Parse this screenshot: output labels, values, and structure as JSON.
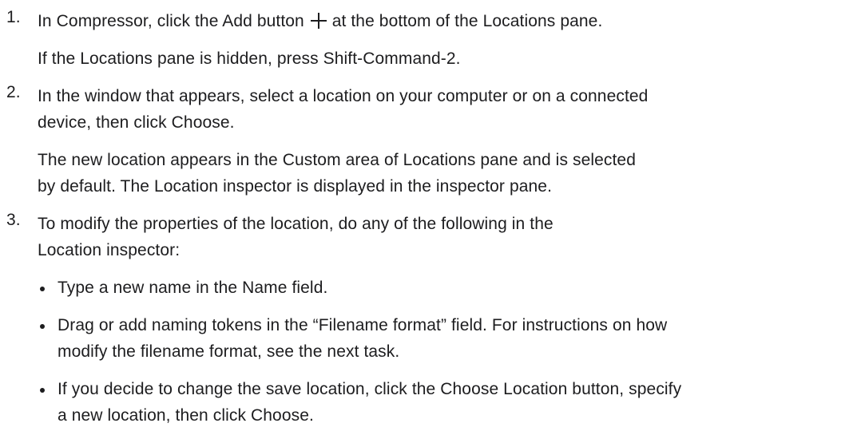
{
  "steps": [
    {
      "number": "1.",
      "line1_pre": "In Compressor, click the Add button",
      "line1_icon": "plus-icon",
      "line1_post": "at the bottom of the Locations pane.",
      "note": "If the Locations pane is hidden, press Shift-Command-2."
    },
    {
      "number": "2.",
      "line1": "In the window that appears, select a location on your computer or on a connected",
      "line2": "device, then click Choose.",
      "note_line1": "The new location appears in the Custom area of Locations pane and is selected",
      "note_line2": "by default. The Location inspector is displayed in the inspector pane."
    },
    {
      "number": "3.",
      "line1": "To modify the properties of the location, do any of the following in the",
      "line2": "Location inspector:",
      "bullets": [
        {
          "line1": "Type a new name in the Name field."
        },
        {
          "line1": "Drag or add naming tokens in the “Filename format” field. For instructions on how",
          "line2": "modify the filename format, see the next task."
        },
        {
          "line1": "If you decide to change the save location, click the Choose Location button, specify",
          "line2": "a new location, then click Choose."
        }
      ]
    }
  ]
}
